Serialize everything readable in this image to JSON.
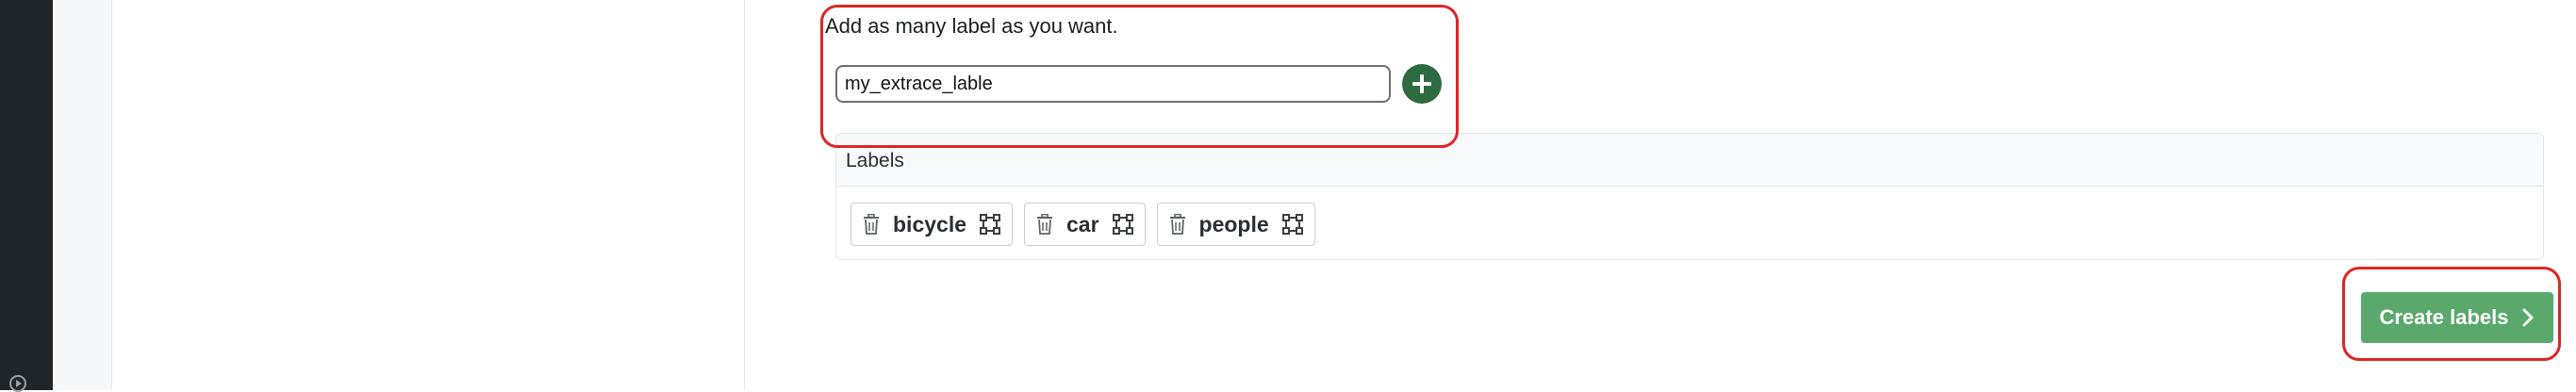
{
  "hint_text": "Add as many label as you want.",
  "label_input": {
    "value": "my_extrace_lable"
  },
  "add_button": {
    "icon": "plus-icon",
    "color": "#2e6b40"
  },
  "labels_panel": {
    "title": "Labels",
    "labels": [
      {
        "name": "bicycle"
      },
      {
        "name": "car"
      },
      {
        "name": "people"
      }
    ]
  },
  "create_button": {
    "label": "Create labels",
    "icon": "chevron-right-icon",
    "color": "#5aa86c"
  },
  "highlight_color": "#e02424"
}
